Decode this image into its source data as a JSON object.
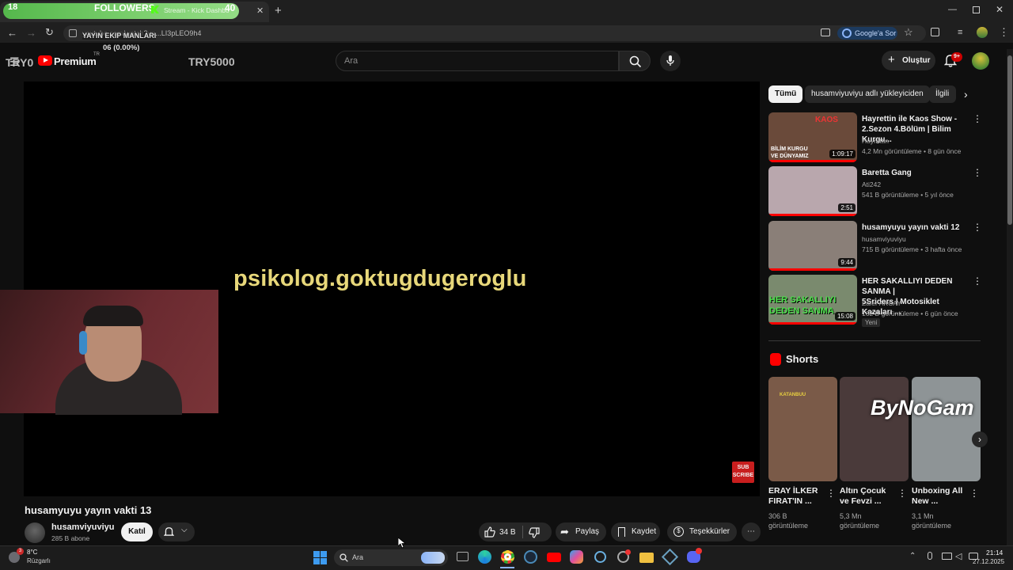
{
  "browser": {
    "tab_title": "Stream - Kick Dashbo",
    "goal_left": "18",
    "goal_label": "FOLLOWERS",
    "goal_right": "40",
    "url": "youtube.com/watch?v=...LI3pLEO9h4",
    "overlay_line1": "YAYIN EKIP MANLARI",
    "overlay_line2": "06 (0.00%)",
    "google_sor": "Google'a Sor"
  },
  "yt": {
    "logo": "Premium",
    "region": "TR",
    "overlay_left": "TRY0",
    "overlay_right": "TRY5000",
    "search_placeholder": "Ara",
    "create_label": "Oluştur",
    "notif_count": "9+"
  },
  "player": {
    "caption": "psikolog.goktugdugeroglu",
    "subscribe_badge1": "SUB",
    "subscribe_badge2": "SCRIBE"
  },
  "video": {
    "title": "husamyuyu yayın vakti 13",
    "channel": "husamviyuviyu",
    "subs": "285 B abone",
    "join": "Katıl",
    "likes": "34 B",
    "share": "Paylaş",
    "save": "Kaydet",
    "thanks": "Teşekkürler"
  },
  "chips": [
    "Tümü",
    "husamviyuviyu adlı yükleyiciden",
    "İlgili"
  ],
  "related": [
    {
      "title1": "Hayrettin ile Kaos Show -",
      "title2": "2.Sezon 4.Bölüm | Bilim Kurgu...",
      "channel": "Hayrettin",
      "meta": "4,2 Mn görüntüleme • 8 gün önce",
      "duration": "1:09:17",
      "thumb": "#6a4a3a"
    },
    {
      "title1": "Baretta Gang",
      "title2": "",
      "channel": "Ati242",
      "meta": "541 B görüntüleme • 5 yıl önce",
      "duration": "2:51",
      "thumb": "#b9a7ad"
    },
    {
      "title1": "husamyuyu yayın vakti 12",
      "title2": "",
      "channel": "husamviyuviyu",
      "meta": "715 B görüntüleme • 3 hafta önce",
      "duration": "9:44",
      "thumb": "#8a7f78"
    },
    {
      "title1": "HER SAKALLIYI DEDEN SANMA |",
      "title2": "5Sriders | Motosiklet Kazaları ...",
      "channel": "Zafer AKCAY",
      "meta": "162 B görüntüleme • 6 gün önce",
      "duration": "15:08",
      "badge": "Yeni",
      "thumb": "#7a8a6e",
      "thumb_text1": "HER SAKALLIYI",
      "thumb_text2": "DEDEN SANMA"
    }
  ],
  "shorts": {
    "header": "Shorts",
    "items": [
      {
        "title1": "ERAY İLKER",
        "title2": "FIRAT'IN ...",
        "views1": "306 B",
        "views2": "görüntüleme",
        "thumb": "#7a5a48"
      },
      {
        "title1": "Altın Çocuk",
        "title2": "ve Fevzi ...",
        "views1": "5,3 Mn",
        "views2": "görüntüleme",
        "thumb": "#4a3a3a"
      },
      {
        "title1": "Unboxing All",
        "title2": "New ...",
        "views1": "3,1 Mn",
        "views2": "görüntüleme",
        "thumb": "#8e9496"
      }
    ],
    "watermark": "ByNoGam"
  },
  "thumb_texts": {
    "kaos": "KAOS",
    "bilim1": "BİLİM KURGU",
    "bilim2": "VE DÜNYAMIZ",
    "katanbuu": "KATANBUU"
  },
  "taskbar": {
    "weather_temp": "8°C",
    "weather_desc": "Rüzgarlı",
    "weather_badge": "3",
    "search": "Ara",
    "time": "21:14",
    "date": "27.12.2025"
  },
  "colors": {
    "accent_red": "#ff0000",
    "goal_green": "#55b84c",
    "bg": "#0f0f0f"
  }
}
